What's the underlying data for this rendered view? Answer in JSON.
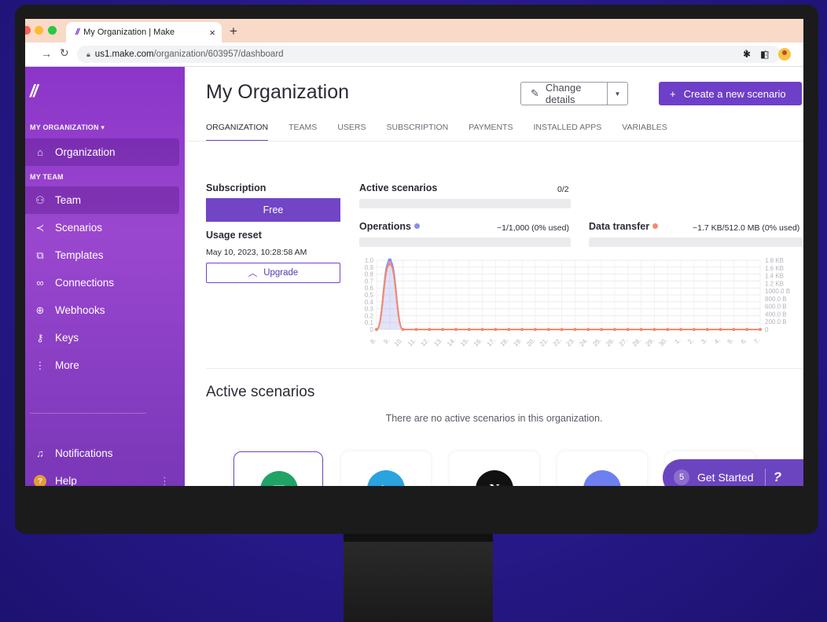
{
  "browser": {
    "tab_title": "My Organization | Make",
    "tab_favicon": "//",
    "tab_close": "×",
    "new_tab": "+",
    "url_host": "us1.make.com",
    "url_path": "/organization/603957/dashboard"
  },
  "sidebar": {
    "logo": "//",
    "org_section": "MY ORGANIZATION ▾",
    "team_section": "MY TEAM",
    "items": [
      {
        "label": "Organization",
        "icon": "home-icon"
      },
      {
        "label": "Team",
        "icon": "team-icon"
      },
      {
        "label": "Scenarios",
        "icon": "share-icon"
      },
      {
        "label": "Templates",
        "icon": "puzzle-icon"
      },
      {
        "label": "Connections",
        "icon": "link-icon"
      },
      {
        "label": "Webhooks",
        "icon": "globe-icon"
      },
      {
        "label": "Keys",
        "icon": "key-icon"
      },
      {
        "label": "More",
        "icon": "more-vertical-icon"
      }
    ],
    "bottom": [
      {
        "label": "Notifications",
        "icon": "bell-icon"
      },
      {
        "label": "Help",
        "icon": "help-icon",
        "badge": "?"
      }
    ]
  },
  "header": {
    "title": "My Organization",
    "change_details": "Change details",
    "create_scenario": "Create a new scenario",
    "create_plus": "+"
  },
  "tabs": [
    "ORGANIZATION",
    "TEAMS",
    "USERS",
    "SUBSCRIPTION",
    "PAYMENTS",
    "INSTALLED APPS",
    "VARIABLES"
  ],
  "subscription": {
    "label": "Subscription",
    "plan": "Free",
    "usage_reset_label": "Usage reset",
    "usage_reset_date": "May 10, 2023, 10:28:58 AM",
    "upgrade": "Upgrade",
    "upgrade_caret": "^"
  },
  "stats": {
    "active_label": "Active scenarios",
    "active_value": "0/2",
    "operations_label": "Operations",
    "operations_value": "~1/1,000 (0% used)",
    "operations_fill": 0.0,
    "transfer_label": "Data transfer",
    "transfer_value": "~1.7 KB/512.0 MB (0% used)",
    "transfer_fill": 0.0
  },
  "colors": {
    "accent": "#6e3fc8",
    "operations": "#8b8de8",
    "transfer": "#f48a6a"
  },
  "chart_data": {
    "type": "line",
    "x": [
      "8.",
      "9.",
      "10.",
      "11.",
      "12.",
      "13.",
      "14.",
      "15.",
      "16.",
      "17.",
      "18.",
      "19.",
      "20.",
      "21.",
      "22.",
      "23.",
      "24.",
      "25.",
      "26.",
      "27.",
      "28.",
      "29.",
      "30.",
      "1.",
      "2.",
      "3.",
      "4.",
      "5.",
      "6.",
      "7."
    ],
    "y_left_ticks": [
      "0",
      "0.1",
      "0.2",
      "0.3",
      "0.4",
      "0.5",
      "0.6",
      "0.7",
      "0.8",
      "0.9",
      "1.0"
    ],
    "y_right_ticks": [
      "0",
      "200.0 B",
      "400.0 B",
      "600.0 B",
      "800.0 B",
      "1000.0 B",
      "1.2 KB",
      "1.4 KB",
      "1.6 KB",
      "1.8 KB"
    ],
    "ylim_left": [
      0,
      1.0
    ],
    "ylim_right": [
      0,
      1.8
    ],
    "series": [
      {
        "values": [
          0,
          1,
          0,
          0,
          0,
          0,
          0,
          0,
          0,
          0,
          0,
          0,
          0,
          0,
          0,
          0,
          0,
          0,
          0,
          0,
          0,
          0,
          0,
          0,
          0,
          0,
          0,
          0,
          0,
          0
        ]
      },
      {
        "values": [
          0,
          1.7,
          0,
          0,
          0,
          0,
          0,
          0,
          0,
          0,
          0,
          0,
          0,
          0,
          0,
          0,
          0,
          0,
          0,
          0,
          0,
          0,
          0,
          0,
          0,
          0,
          0,
          0,
          0,
          0
        ]
      }
    ]
  },
  "active_section": {
    "title": "Active scenarios",
    "empty_message": "There are no active scenarios in this organization."
  },
  "apps": [
    {
      "name": "google-sheets",
      "glyph": "▦",
      "color": "#21a365"
    },
    {
      "name": "telegram",
      "glyph": "➤",
      "color": "#2aa3df"
    },
    {
      "name": "notion",
      "glyph": "N",
      "color": "#111111"
    },
    {
      "name": "discord",
      "glyph": "◕",
      "color": "#6f7ff0"
    },
    {
      "name": "openai",
      "glyph": "",
      "color": "#25a6e6"
    }
  ],
  "get_started": {
    "count": "5",
    "label": "Get Started",
    "icon": "?"
  }
}
